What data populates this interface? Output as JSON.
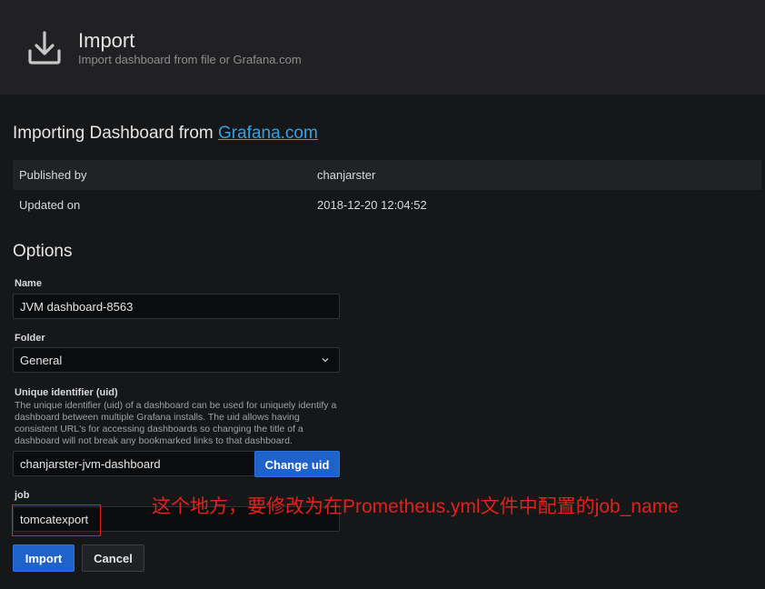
{
  "header": {
    "title": "Import",
    "subtitle": "Import dashboard from file or Grafana.com",
    "icon": "download-icon"
  },
  "import_section": {
    "heading_prefix": "Importing Dashboard from ",
    "heading_link": "Grafana.com",
    "rows": [
      {
        "key": "Published by",
        "value": "chanjarster"
      },
      {
        "key": "Updated on",
        "value": "2018-12-20 12:04:52"
      }
    ]
  },
  "options": {
    "heading": "Options",
    "name": {
      "label": "Name",
      "value": "JVM dashboard-8563"
    },
    "folder": {
      "label": "Folder",
      "value": "General"
    },
    "uid": {
      "label": "Unique identifier (uid)",
      "description": "The unique identifier (uid) of a dashboard can be used for uniquely identify a dashboard between multiple Grafana installs. The uid allows having consistent URL's for accessing dashboards so changing the title of a dashboard will not break any bookmarked links to that dashboard.",
      "value": "chanjarster-jvm-dashboard",
      "button": "Change uid"
    },
    "job": {
      "label": "job",
      "value": "tomcatexport"
    }
  },
  "actions": {
    "import": "Import",
    "cancel": "Cancel"
  },
  "annotation": {
    "text": "这个地方，要修改为在Prometheus.yml文件中配置的job_name",
    "color": "#e0221c"
  },
  "colors": {
    "primary": "#1f62c9",
    "link": "#33a2e5",
    "background": "#161719"
  }
}
